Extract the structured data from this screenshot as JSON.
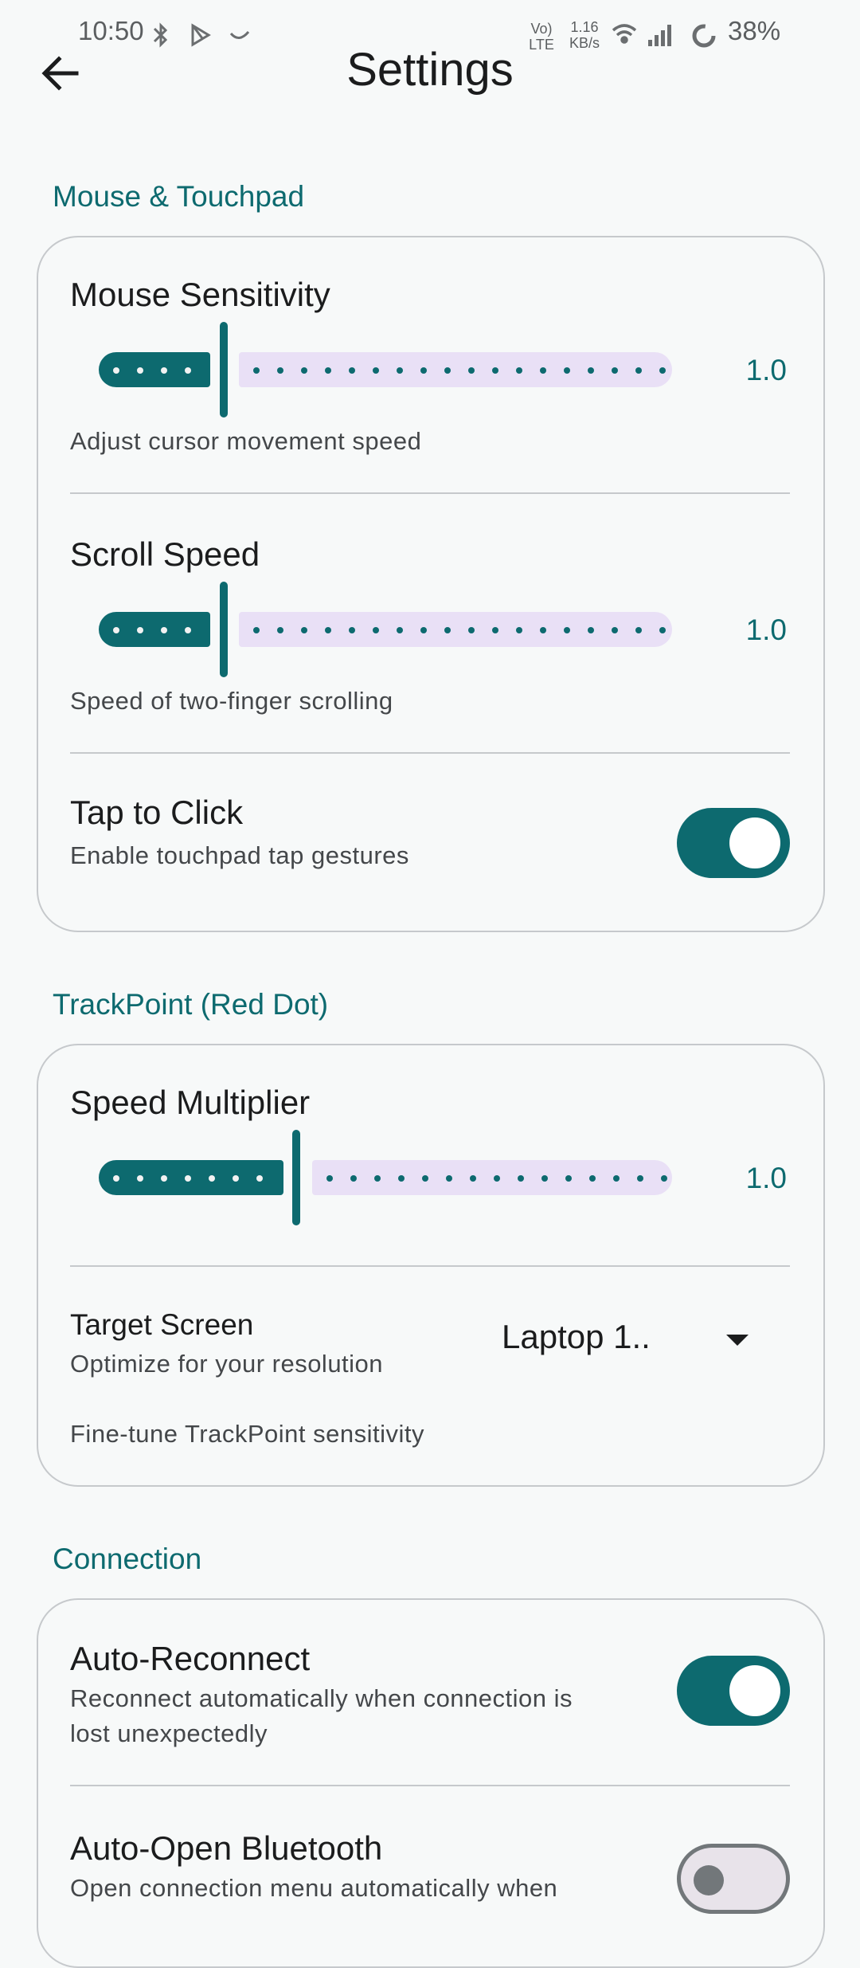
{
  "status_bar": {
    "time": "10:50",
    "net_speed_value": "1.16",
    "net_speed_unit": "KB/s",
    "volte_top": "Vo)",
    "volte_bottom": "LTE",
    "battery": "38%"
  },
  "header": {
    "title": "Settings"
  },
  "sections": {
    "mouse": {
      "title": "Mouse & Touchpad",
      "mouse_sensitivity": {
        "label": "Mouse Sensitivity",
        "value": "1.0",
        "description": "Adjust cursor movement speed",
        "fill_fraction": 0.22
      },
      "scroll_speed": {
        "label": "Scroll Speed",
        "value": "1.0",
        "description": "Speed of two-finger scrolling",
        "fill_fraction": 0.22
      },
      "tap_to_click": {
        "label": "Tap to Click",
        "description": "Enable touchpad tap gestures",
        "enabled": true
      }
    },
    "trackpoint": {
      "title": "TrackPoint (Red Dot)",
      "speed_multiplier": {
        "label": "Speed Multiplier",
        "value": "1.0",
        "fill_fraction": 0.35
      },
      "target_screen": {
        "label": "Target Screen",
        "description": "Optimize for your resolution",
        "selected": "Laptop 1.."
      },
      "footer": "Fine-tune TrackPoint sensitivity"
    },
    "connection": {
      "title": "Connection",
      "auto_reconnect": {
        "label": "Auto-Reconnect",
        "description_line1": "Reconnect automatically when connection is",
        "description_line2": "lost unexpectedly",
        "enabled": true
      },
      "auto_open_bluetooth": {
        "label": "Auto-Open Bluetooth",
        "description_line1": "Open connection menu automatically when",
        "enabled": false
      }
    }
  },
  "colors": {
    "accent": "#0d6a6f",
    "track_inactive": "#e9e0f6",
    "background": "#f7f9f9"
  }
}
